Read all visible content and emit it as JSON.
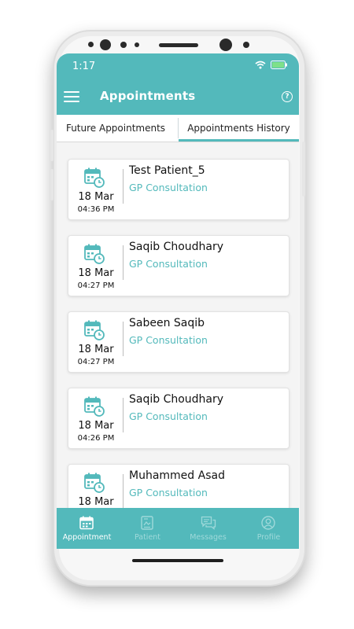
{
  "status_bar": {
    "time": "1:17"
  },
  "header": {
    "title": "Appointments",
    "menu_icon": "hamburger-menu-icon",
    "help_icon": "help-icon",
    "help_glyph": "?"
  },
  "tabs": [
    {
      "label": "Future Appointments",
      "active": false
    },
    {
      "label": "Appointments History",
      "active": true
    }
  ],
  "appointments": [
    {
      "name": "Test Patient_5",
      "type": "GP Consultation",
      "date": "18 Mar",
      "time": "04:36 PM"
    },
    {
      "name": "Saqib Choudhary",
      "type": "GP Consultation",
      "date": "18 Mar",
      "time": "04:27 PM"
    },
    {
      "name": "Sabeen Saqib",
      "type": "GP Consultation",
      "date": "18 Mar",
      "time": "04:27 PM"
    },
    {
      "name": "Saqib Choudhary",
      "type": "GP Consultation",
      "date": "18 Mar",
      "time": "04:26 PM"
    },
    {
      "name": "Muhammed Asad",
      "type": "GP Consultation",
      "date": "18 Mar",
      "time": ""
    }
  ],
  "bottom_nav": [
    {
      "label": "Appointment",
      "icon": "calendar-icon",
      "active": true
    },
    {
      "label": "Patient",
      "icon": "patient-record-icon",
      "active": false
    },
    {
      "label": "Messages",
      "icon": "messages-icon",
      "active": false
    },
    {
      "label": "Profile",
      "icon": "profile-icon",
      "active": false
    }
  ],
  "colors": {
    "primary": "#53b9bb",
    "nav_inactive": "#9fd9da",
    "nav_active": "#ffffff"
  }
}
